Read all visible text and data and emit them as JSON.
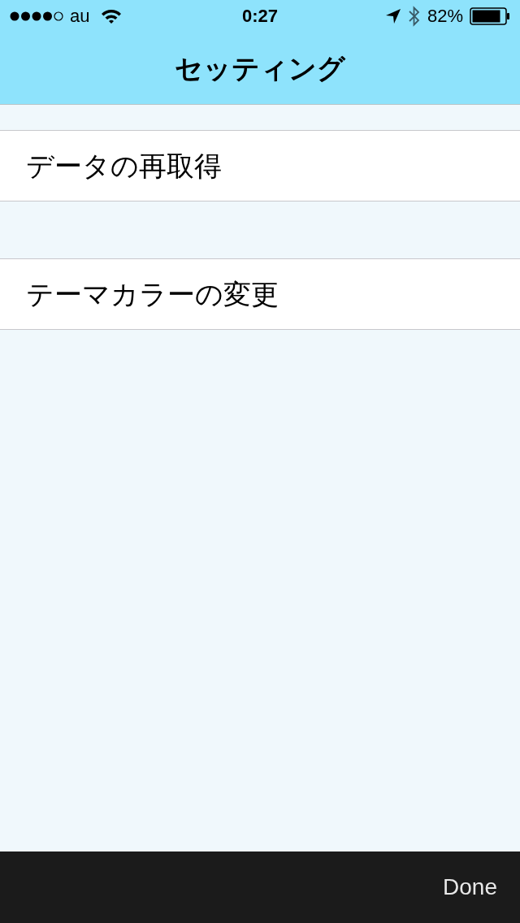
{
  "status_bar": {
    "carrier": "au",
    "time": "0:27",
    "battery": "82%"
  },
  "navigation_bar": {
    "title": "セッティング"
  },
  "sections": [
    {
      "items": [
        {
          "label": "データの再取得"
        }
      ]
    },
    {
      "items": [
        {
          "label": "テーマカラーの変更"
        }
      ]
    }
  ],
  "toolbar": {
    "done_button": "Done"
  }
}
